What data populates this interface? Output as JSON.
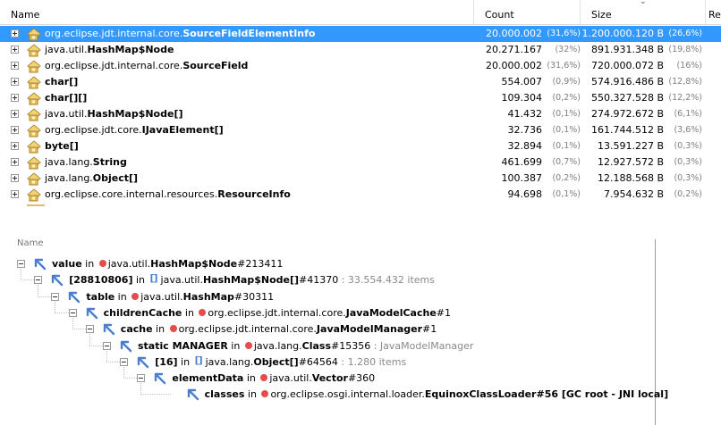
{
  "table": {
    "headers": {
      "name": "Name",
      "count": "Count",
      "size": "Size",
      "retained": "Re"
    },
    "sort_indicator": "⌄",
    "rows": [
      {
        "prefix": "org.eclipse.jdt.internal.core.",
        "bold": "SourceFieldElementInfo",
        "count": "20.000.002",
        "count_pct": "(31,6%)",
        "size": "1.200.000.120 B",
        "size_pct": "(26,6%)",
        "selected": true
      },
      {
        "prefix": "java.util.",
        "bold": "HashMap$Node",
        "count": "20.271.167",
        "count_pct": "(32%)",
        "size": "891.931.348 B",
        "size_pct": "(19,8%)",
        "selected": false
      },
      {
        "prefix": "org.eclipse.jdt.internal.core.",
        "bold": "SourceField",
        "count": "20.000.002",
        "count_pct": "(31,6%)",
        "size": "720.000.072 B",
        "size_pct": "(16%)",
        "selected": false
      },
      {
        "prefix": "",
        "bold": "char[]",
        "count": "554.007",
        "count_pct": "(0,9%)",
        "size": "574.916.486 B",
        "size_pct": "(12,8%)",
        "selected": false
      },
      {
        "prefix": "",
        "bold": "char[][]",
        "count": "109.304",
        "count_pct": "(0,2%)",
        "size": "550.327.528 B",
        "size_pct": "(12,2%)",
        "selected": false
      },
      {
        "prefix": "java.util.",
        "bold": "HashMap$Node[]",
        "count": "41.432",
        "count_pct": "(0,1%)",
        "size": "274.972.672 B",
        "size_pct": "(6,1%)",
        "selected": false
      },
      {
        "prefix": "org.eclipse.jdt.core.",
        "bold": "IJavaElement[]",
        "count": "32.736",
        "count_pct": "(0,1%)",
        "size": "161.744.512 B",
        "size_pct": "(3,6%)",
        "selected": false
      },
      {
        "prefix": "",
        "bold": "byte[]",
        "count": "32.894",
        "count_pct": "(0,1%)",
        "size": "13.591.227 B",
        "size_pct": "(0,3%)",
        "selected": false
      },
      {
        "prefix": "java.lang.",
        "bold": "String",
        "count": "461.699",
        "count_pct": "(0,7%)",
        "size": "12.927.572 B",
        "size_pct": "(0,3%)",
        "selected": false
      },
      {
        "prefix": "java.lang.",
        "bold": "Object[]",
        "count": "100.387",
        "count_pct": "(0,2%)",
        "size": "12.188.568 B",
        "size_pct": "(0,3%)",
        "selected": false
      },
      {
        "prefix": "org.eclipse.core.internal.resources.",
        "bold": "ResourceInfo",
        "count": "94.698",
        "count_pct": "(0,1%)",
        "size": "7.954.632 B",
        "size_pct": "(0,2%)",
        "selected": false
      }
    ]
  },
  "tree": {
    "header": "Name",
    "nodes": [
      {
        "field": "value",
        "in": " in ",
        "type_prefix": "java.util.",
        "type_bold": "HashMap$Node",
        "suffix": "#213411",
        "note": "",
        "array": false
      },
      {
        "field": "[28810806]",
        "in": " in ",
        "type_prefix": "java.util.",
        "type_bold": "HashMap$Node[]",
        "suffix": "#41370",
        "note": " : 33.554.432 items",
        "array": true
      },
      {
        "field": "table",
        "in": " in ",
        "type_prefix": "java.util.",
        "type_bold": "HashMap",
        "suffix": "#30311",
        "note": "",
        "array": false
      },
      {
        "field": "childrenCache",
        "in": " in ",
        "type_prefix": "org.eclipse.jdt.internal.core.",
        "type_bold": "JavaModelCache",
        "suffix": "#1",
        "note": "",
        "array": false
      },
      {
        "field": "cache",
        "in": " in ",
        "type_prefix": "org.eclipse.jdt.internal.core.",
        "type_bold": "JavaModelManager",
        "suffix": "#1",
        "note": "",
        "array": false
      },
      {
        "field": "static MANAGER",
        "in": " in ",
        "type_prefix": "java.lang.",
        "type_bold": "Class",
        "suffix": "#15356",
        "note": " : JavaModelManager",
        "array": false
      },
      {
        "field": "[16]",
        "in": " in ",
        "type_prefix": "java.lang.",
        "type_bold": "Object[]",
        "suffix": "#64564",
        "note": " : 1.280 items",
        "array": true
      },
      {
        "field": "elementData",
        "in": " in ",
        "type_prefix": "java.util.",
        "type_bold": "Vector",
        "suffix": "#360",
        "note": "",
        "array": false
      },
      {
        "field": "classes",
        "in": " in ",
        "type_prefix": "org.eclipse.osgi.internal.loader.",
        "type_bold": "EquinoxClassLoader",
        "suffix": "#56 [GC root - JNI local]",
        "note": "",
        "array": false
      }
    ]
  },
  "colors": {
    "selection": "#3399ff",
    "instance_dot": "#e74c4c",
    "reference_arrow": "#4a7fd0"
  },
  "icons": {
    "class_row": "class-package-icon",
    "reference": "reference-arrow-icon",
    "instance": "instance-dot-icon",
    "array": "array-brackets-icon"
  }
}
